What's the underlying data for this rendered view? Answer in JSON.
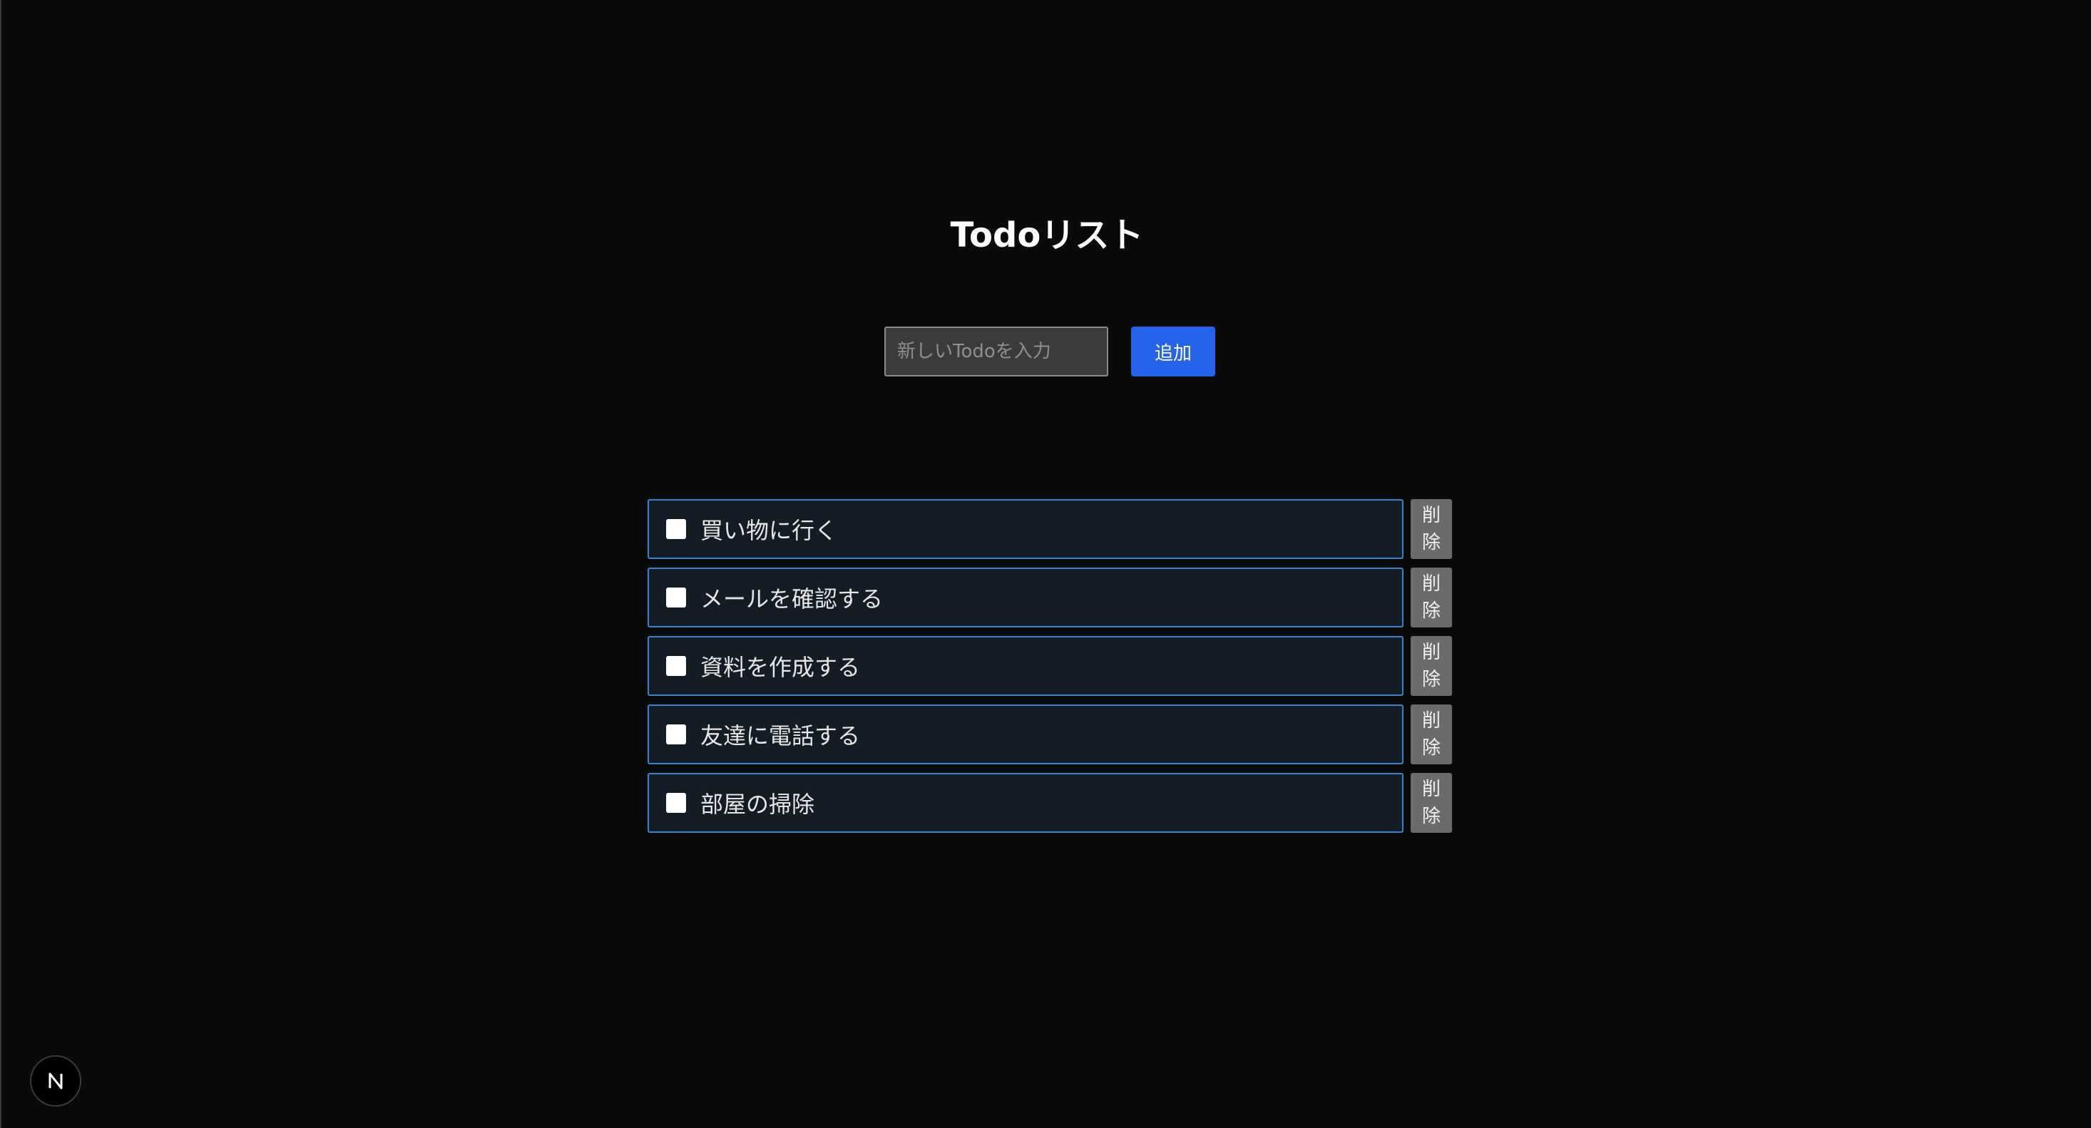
{
  "header": {
    "title": "Todoリスト"
  },
  "form": {
    "input_value": "",
    "input_placeholder": "新しいTodoを入力",
    "add_label": "追加"
  },
  "todos": [
    {
      "text": "買い物に行く",
      "checked": false,
      "delete_line1": "削",
      "delete_line2": "除"
    },
    {
      "text": "メールを確認する",
      "checked": false,
      "delete_line1": "削",
      "delete_line2": "除"
    },
    {
      "text": "資料を作成する",
      "checked": false,
      "delete_line1": "削",
      "delete_line2": "除"
    },
    {
      "text": "友達に電話する",
      "checked": false,
      "delete_line1": "削",
      "delete_line2": "除"
    },
    {
      "text": "部屋の掃除",
      "checked": false,
      "delete_line1": "削",
      "delete_line2": "除"
    }
  ],
  "dev_badge": {
    "icon": "nextjs-logo-icon",
    "letter": "N"
  },
  "colors": {
    "background": "#0a0a0a",
    "accent": "#2563eb",
    "item_border": "#3b82c6",
    "item_background": "#141c26",
    "delete_button": "#6b6b6b"
  }
}
